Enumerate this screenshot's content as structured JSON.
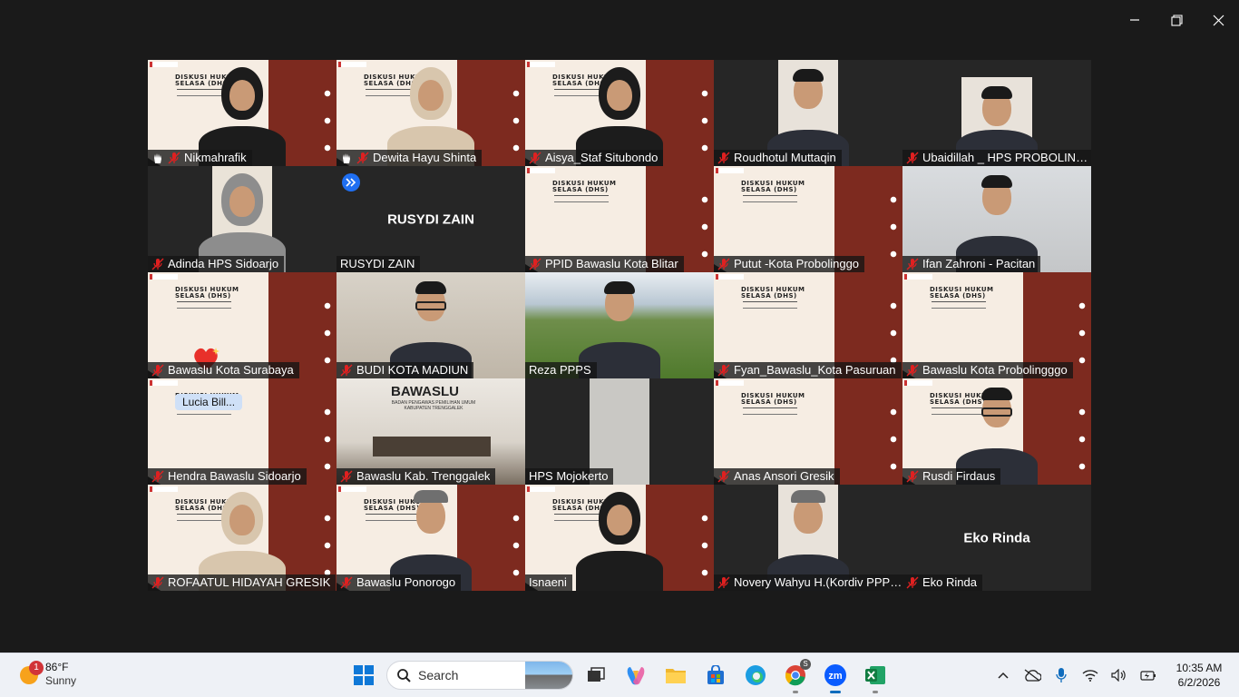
{
  "participants": [
    {
      "name": "Nikmahrafik",
      "kind": "slide",
      "person": "hijab-black",
      "raised": true
    },
    {
      "name": "Dewita Hayu Shinta",
      "kind": "slide",
      "person": "hijab-beige",
      "raised": true,
      "active": true
    },
    {
      "name": "Aisya_Staf Situbondo",
      "kind": "slide",
      "person": "hijab-black"
    },
    {
      "name": "Roudhotul Muttaqin",
      "kind": "inset",
      "person": "man"
    },
    {
      "name": "Ubaidillah _ HPS PROBOLING...",
      "kind": "inset-small",
      "person": "man"
    },
    {
      "name": "Adinda HPS Sidoarjo",
      "kind": "inset",
      "person": "hijab-grey"
    },
    {
      "name": "RUSYDI ZAIN",
      "kind": "noimage",
      "center": "RUSYDI ZAIN",
      "sharing": true,
      "micoff": false
    },
    {
      "name": "PPID Bawaslu Kota Blitar",
      "kind": "slide"
    },
    {
      "name": "Putut -Kota Probolinggo",
      "kind": "slide"
    },
    {
      "name": "Ifan Zahroni - Pacitan",
      "kind": "camera",
      "person": "man-close"
    },
    {
      "name": "Bawaslu Kota Surabaya",
      "kind": "slide",
      "heart": true
    },
    {
      "name": "BUDI KOTA MADIUN",
      "kind": "camera",
      "person": "man-glasses"
    },
    {
      "name": "Reza PPPS",
      "kind": "landscape",
      "person": "man",
      "micoff": false
    },
    {
      "name": "Fyan_Bawaslu_Kota Pasuruan",
      "kind": "slide"
    },
    {
      "name": "Bawaslu Kota Probolingggo",
      "kind": "slide"
    },
    {
      "name": "Hendra Bawaslu Sidoarjo",
      "kind": "slide",
      "chip": "Lucia  Bill..."
    },
    {
      "name": "Bawaslu Kab. Trenggalek",
      "kind": "room",
      "room_title": "BAWASLU",
      "room_sub": "BADAN PENGAWAS PEMILIHAN UMUM KABUPATEN TRENGGALEK"
    },
    {
      "name": "HPS Mojokerto",
      "kind": "inset-grey",
      "micoff": false
    },
    {
      "name": "Anas Ansori Gresik",
      "kind": "slide"
    },
    {
      "name": "Rusdi Firdaus",
      "kind": "slide",
      "person": "man-glasses"
    },
    {
      "name": "ROFAATUL HIDAYAH GRESIK",
      "kind": "slide",
      "person": "hijab-beige"
    },
    {
      "name": "Bawaslu Ponorogo",
      "kind": "slide",
      "person": "man-cap"
    },
    {
      "name": "Isnaeni",
      "kind": "slide",
      "person": "hijab-black",
      "micoff": false
    },
    {
      "name": "Novery Wahyu H.(Kordiv PPPS...",
      "kind": "inset",
      "person": "man-cap"
    },
    {
      "name": "Eko Rinda",
      "kind": "noimage",
      "center": "Eko Rinda"
    }
  ],
  "slide_title_lines": [
    "DISKUSI HUKUM",
    "SELASA (DHS)"
  ],
  "taskbar": {
    "weather_temp": "86°F",
    "weather_desc": "Sunny",
    "notif_count": "1",
    "search_label": "Search",
    "time": "10:35 AM",
    "date": "6/2/2026",
    "chrome_badge": "S"
  },
  "colors": {
    "active_speaker": "#23d96b",
    "slide_maroon": "#7d2a1f",
    "slide_cream": "#f6ede3",
    "mic_off": "#e02020"
  }
}
